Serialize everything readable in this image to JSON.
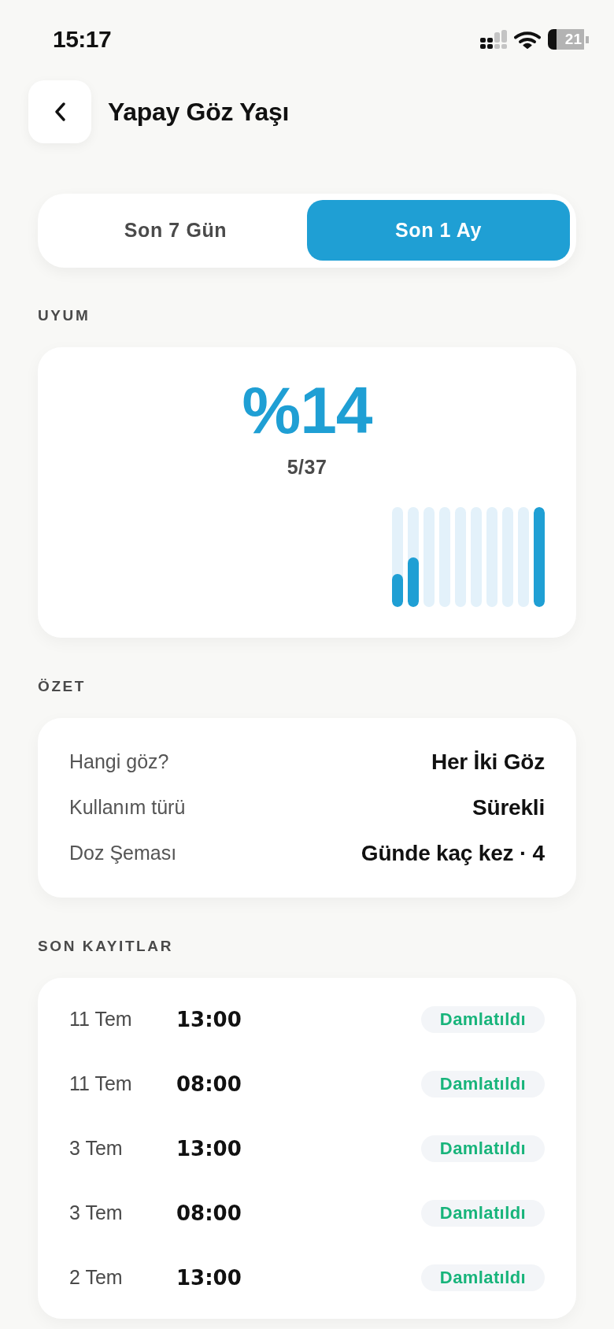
{
  "status_bar": {
    "time": "15:17",
    "battery": "21"
  },
  "header": {
    "title": "Yapay Göz Yaşı"
  },
  "period_tabs": [
    {
      "label": "Son 7 Gün",
      "selected": false
    },
    {
      "label": "Son 1 Ay",
      "selected": true
    }
  ],
  "adherence": {
    "heading": "UYUM",
    "percent": "%14",
    "count": "5/37"
  },
  "summary": {
    "heading": "ÖZET",
    "rows": [
      {
        "label": "Hangi göz?",
        "value": "Her İki Göz"
      },
      {
        "label": "Kullanım türü",
        "value": "Sürekli"
      },
      {
        "label": "Doz Şeması",
        "value": "Günde kaç kez · 4"
      }
    ]
  },
  "recent_records": {
    "heading": "SON KAYITLAR",
    "rows": [
      {
        "date": "11 Tem",
        "time": "13:00",
        "status": "Damlatıldı"
      },
      {
        "date": "11 Tem",
        "time": "08:00",
        "status": "Damlatıldı"
      },
      {
        "date": "3 Tem",
        "time": "13:00",
        "status": "Damlatıldı"
      },
      {
        "date": "3 Tem",
        "time": "08:00",
        "status": "Damlatıldı"
      },
      {
        "date": "2 Tem",
        "time": "13:00",
        "status": "Damlatıldı"
      }
    ]
  }
}
